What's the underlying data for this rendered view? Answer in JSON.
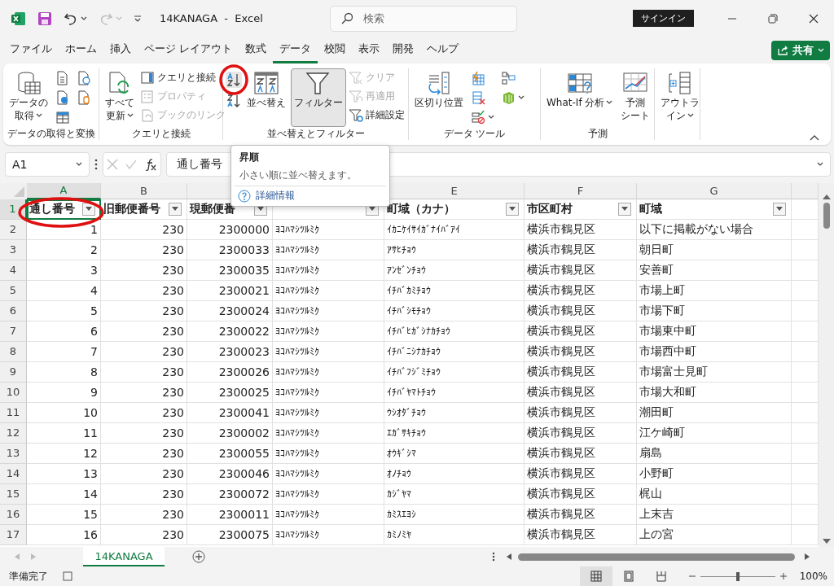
{
  "window": {
    "title": "14KANAGA  -  Excel",
    "search": {
      "placeholder": "検索"
    },
    "sign_in": "サインイン"
  },
  "menu_tabs": [
    {
      "label": "ファイル",
      "selected": false
    },
    {
      "label": "ホーム",
      "selected": false
    },
    {
      "label": "挿入",
      "selected": false
    },
    {
      "label": "ページ レイアウト",
      "selected": false
    },
    {
      "label": "数式",
      "selected": false
    },
    {
      "label": "データ",
      "selected": true
    },
    {
      "label": "校閲",
      "selected": false
    },
    {
      "label": "表示",
      "selected": false
    },
    {
      "label": "開発",
      "selected": false
    },
    {
      "label": "ヘルプ",
      "selected": false
    }
  ],
  "share_button": "共有",
  "ribbon": {
    "groups": [
      {
        "label": "データの取得と変換",
        "large": [
          {
            "lines": [
              "データの",
              "取得"
            ],
            "caret": true,
            "pressed": false
          }
        ]
      },
      {
        "label": "クエリと接続",
        "large": [
          {
            "lines": [
              "すべて",
              "更新"
            ],
            "caret": true,
            "pressed": false
          }
        ],
        "small": [
          {
            "label": "クエリと接続",
            "disabled": false
          },
          {
            "label": "プロパティ",
            "disabled": true
          },
          {
            "label": "ブックのリンク",
            "disabled": true
          }
        ]
      },
      {
        "label": "並べ替えとフィルター",
        "large": [
          {
            "lines": [
              "並べ替え"
            ],
            "caret": false,
            "pressed": false
          },
          {
            "lines": [
              "フィルター"
            ],
            "caret": false,
            "pressed": true
          }
        ],
        "small": [
          {
            "label": "クリア",
            "disabled": true
          },
          {
            "label": "再適用",
            "disabled": true
          },
          {
            "label": "詳細設定",
            "disabled": false
          }
        ]
      },
      {
        "label": "データ ツール",
        "large": [
          {
            "lines": [
              "区切り位置"
            ],
            "caret": false,
            "pressed": false
          }
        ]
      },
      {
        "label": "予測",
        "large": [
          {
            "lines": [
              "What-If 分析"
            ],
            "caret": true,
            "pressed": false
          },
          {
            "lines": [
              "予測",
              "シート"
            ],
            "caret": false,
            "pressed": false
          }
        ]
      },
      {
        "large": [
          {
            "lines": [
              "アウトラ",
              "イン"
            ],
            "caret": true,
            "pressed": false
          }
        ]
      }
    ]
  },
  "formula_bar": {
    "name_box": "A1",
    "value": "通し番号"
  },
  "sheet": {
    "columns": [
      {
        "label": "A",
        "selected": true
      },
      {
        "label": "B",
        "selected": false
      },
      {
        "selected": false
      },
      {},
      {
        "label": "E",
        "selected": false
      },
      {
        "label": "F",
        "selected": false
      },
      {
        "label": "G",
        "selected": false
      }
    ],
    "header_row": {
      "number": "1",
      "selected": true,
      "cells": [
        {
          "text": "通し番号",
          "filter": true
        },
        {
          "text": "旧郵便番号",
          "filter": true
        },
        {
          "text": "現郵便番",
          "filter": true
        },
        {
          "filter": true
        },
        {
          "text": "町域（カナ）",
          "filter": true
        },
        {
          "text": "市区町村",
          "filter": true
        },
        {
          "text": "町域",
          "filter": true
        }
      ]
    },
    "rows": [
      {
        "number": "2",
        "cells": [
          "1",
          "230",
          "2300000",
          "ﾖｺﾊﾏｼﾂﾙﾐｸ",
          "ｲｶﾆｹｲｻｲｶﾞﾅｲﾊﾞｱｲ",
          "横浜市鶴見区",
          "以下に掲載がない場合"
        ]
      },
      {
        "number": "3",
        "cells": [
          "2",
          "230",
          "2300033",
          "ﾖｺﾊﾏｼﾂﾙﾐｸ",
          "ｱｻﾋﾁｮｳ",
          "横浜市鶴見区",
          "朝日町"
        ]
      },
      {
        "number": "4",
        "cells": [
          "3",
          "230",
          "2300035",
          "ﾖｺﾊﾏｼﾂﾙﾐｸ",
          "ｱﾝｾﾞﾝﾁｮｳ",
          "横浜市鶴見区",
          "安善町"
        ]
      },
      {
        "number": "5",
        "cells": [
          "4",
          "230",
          "2300021",
          "ﾖｺﾊﾏｼﾂﾙﾐｸ",
          "ｲﾁﾊﾞｶﾐﾁｮｳ",
          "横浜市鶴見区",
          "市場上町"
        ]
      },
      {
        "number": "6",
        "cells": [
          "5",
          "230",
          "2300024",
          "ﾖｺﾊﾏｼﾂﾙﾐｸ",
          "ｲﾁﾊﾞｼﾓﾁｮｳ",
          "横浜市鶴見区",
          "市場下町"
        ]
      },
      {
        "number": "7",
        "cells": [
          "6",
          "230",
          "2300022",
          "ﾖｺﾊﾏｼﾂﾙﾐｸ",
          "ｲﾁﾊﾞﾋｶﾞｼﾅｶﾁｮｳ",
          "横浜市鶴見区",
          "市場東中町"
        ]
      },
      {
        "number": "8",
        "cells": [
          "7",
          "230",
          "2300023",
          "ﾖｺﾊﾏｼﾂﾙﾐｸ",
          "ｲﾁﾊﾞﾆｼﾅｶﾁｮｳ",
          "横浜市鶴見区",
          "市場西中町"
        ]
      },
      {
        "number": "9",
        "cells": [
          "8",
          "230",
          "2300026",
          "ﾖｺﾊﾏｼﾂﾙﾐｸ",
          "ｲﾁﾊﾞﾌｼﾞﾐﾁｮｳ",
          "横浜市鶴見区",
          "市場富士見町"
        ]
      },
      {
        "number": "10",
        "cells": [
          "9",
          "230",
          "2300025",
          "ﾖｺﾊﾏｼﾂﾙﾐｸ",
          "ｲﾁﾊﾞﾔﾏﾄﾁｮｳ",
          "横浜市鶴見区",
          "市場大和町"
        ]
      },
      {
        "number": "11",
        "cells": [
          "10",
          "230",
          "2300041",
          "ﾖｺﾊﾏｼﾂﾙﾐｸ",
          "ｳｼｵﾀﾞﾁｮｳ",
          "横浜市鶴見区",
          "潮田町"
        ]
      },
      {
        "number": "12",
        "cells": [
          "11",
          "230",
          "2300002",
          "ﾖｺﾊﾏｼﾂﾙﾐｸ",
          "ｴｶﾞｻｷﾁｮｳ",
          "横浜市鶴見区",
          "江ケ崎町"
        ]
      },
      {
        "number": "13",
        "cells": [
          "12",
          "230",
          "2300055",
          "ﾖｺﾊﾏｼﾂﾙﾐｸ",
          "ｵｳｷﾞｼﾏ",
          "横浜市鶴見区",
          "扇島"
        ]
      },
      {
        "number": "14",
        "cells": [
          "13",
          "230",
          "2300046",
          "ﾖｺﾊﾏｼﾂﾙﾐｸ",
          "ｵﾉﾁｮｳ",
          "横浜市鶴見区",
          "小野町"
        ]
      },
      {
        "number": "15",
        "cells": [
          "14",
          "230",
          "2300072",
          "ﾖｺﾊﾏｼﾂﾙﾐｸ",
          "ｶｼﾞﾔﾏ",
          "横浜市鶴見区",
          "梶山"
        ]
      },
      {
        "number": "16",
        "cells": [
          "15",
          "230",
          "2300011",
          "ﾖｺﾊﾏｼﾂﾙﾐｸ",
          "ｶﾐｽｴﾖｼ",
          "横浜市鶴見区",
          "上末吉"
        ]
      },
      {
        "number": "17",
        "cells": [
          "16",
          "230",
          "2300075",
          "ﾖｺﾊﾏｼﾂﾙﾐｸ",
          "ｶﾐﾉﾐﾔ",
          "横浜市鶴見区",
          "上の宮"
        ]
      }
    ]
  },
  "sheet_tabs": [
    {
      "label": "14KANAGA",
      "selected": true
    }
  ],
  "status_bar": {
    "status": "準備完了",
    "view_buttons": [
      {
        "selected": true
      },
      {
        "selected": false
      },
      {
        "selected": false
      }
    ],
    "zoom": {
      "level": 0.5,
      "label": "100%"
    }
  },
  "tooltip": {
    "title": "昇順",
    "description": "小さい順に並べ替えます。",
    "link": "詳細情報"
  }
}
